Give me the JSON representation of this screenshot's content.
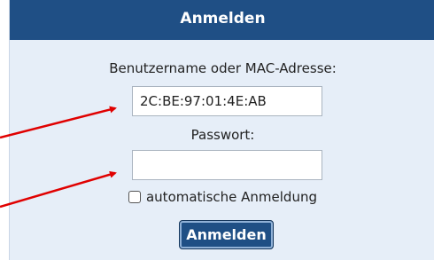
{
  "header": {
    "title": "Anmelden"
  },
  "form": {
    "username_label": "Benutzername oder MAC-Adresse:",
    "username_value": "2C:BE:97:01:4E:AB",
    "password_label": "Passwort:",
    "password_value": "",
    "auto_login_label": "automatische Anmeldung",
    "auto_login_checked": false,
    "submit_label": "Anmelden"
  },
  "colors": {
    "header_bg": "#1f4f85",
    "panel_bg": "#e6eef8",
    "arrow": "#e00000"
  }
}
